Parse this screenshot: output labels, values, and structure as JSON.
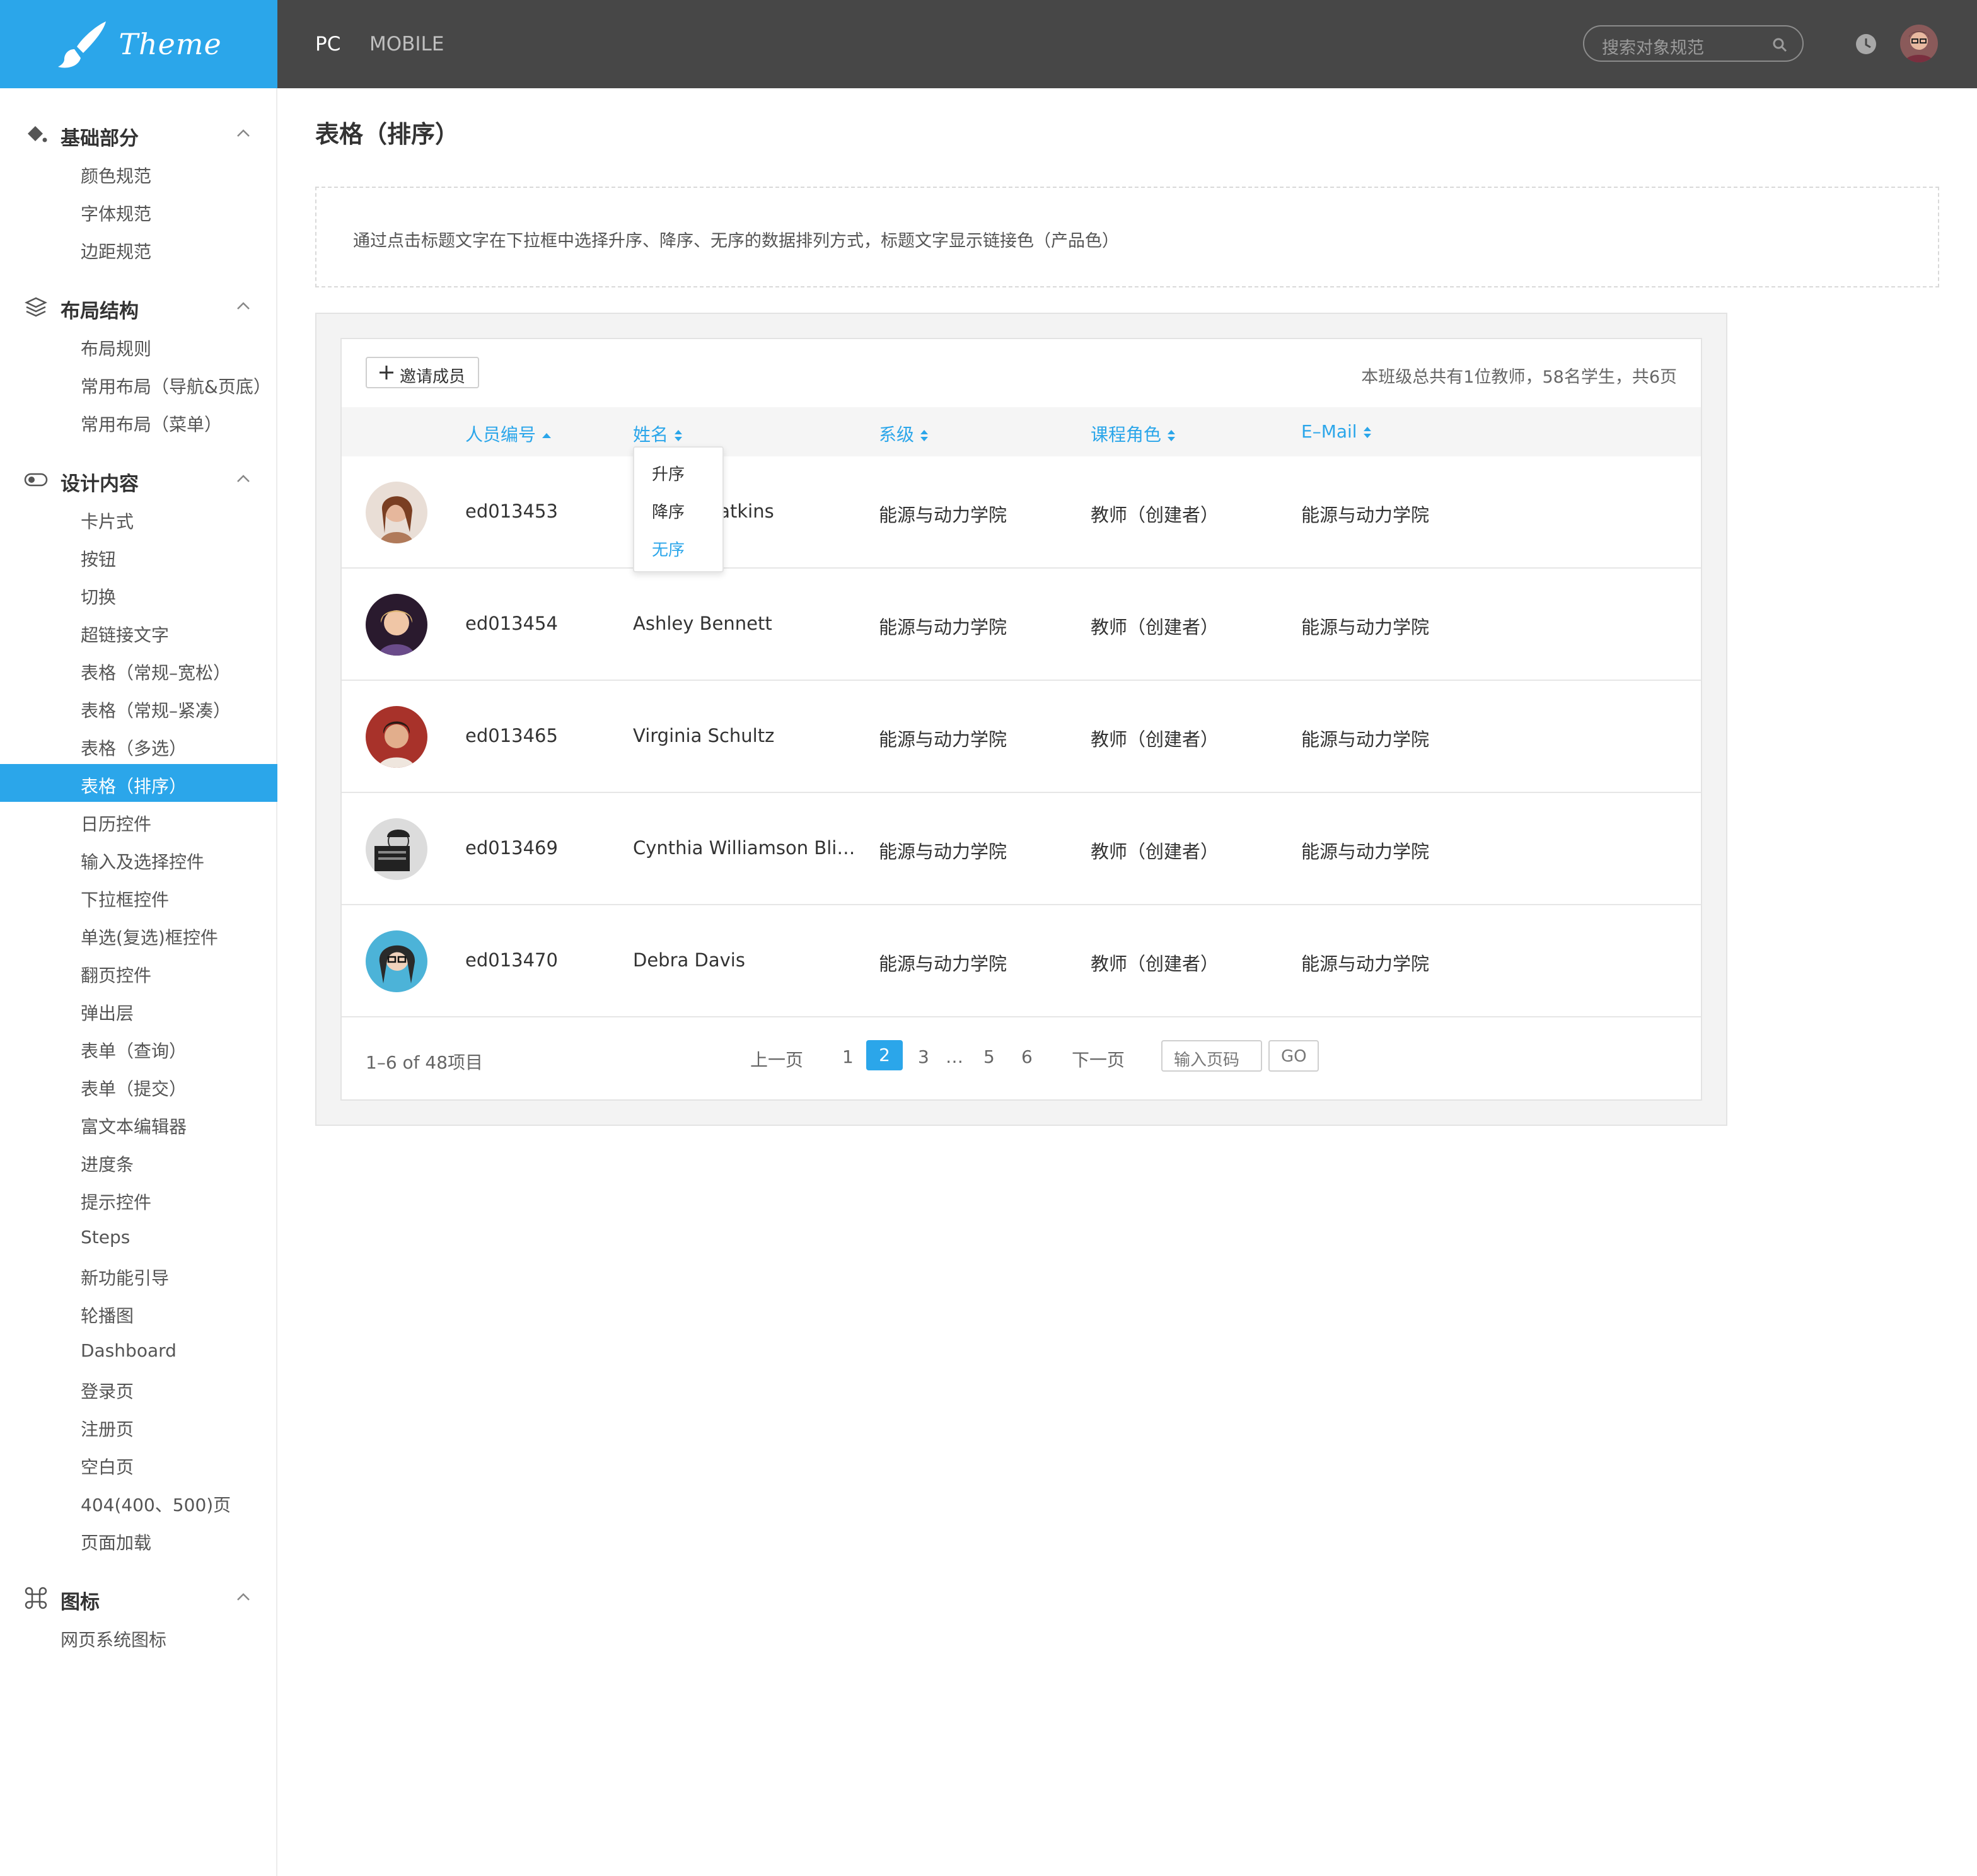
{
  "app": {
    "brand": "Theme",
    "tabs": [
      "PC",
      "MOBILE"
    ],
    "search_placeholder": "搜索对象规范",
    "accent_color": "#2ba6ea",
    "topbar_color": "#474747"
  },
  "sidebar": {
    "groups": [
      {
        "title": "基础部分",
        "icon": "paint-bucket-icon",
        "items": [
          "颜色规范",
          "字体规范",
          "边距规范"
        ]
      },
      {
        "title": "布局结构",
        "icon": "layers-icon",
        "items": [
          "布局规则",
          "常用布局（导航&页底）",
          "常用布局（菜单）"
        ]
      },
      {
        "title": "设计内容",
        "icon": "toggle-icon",
        "items": [
          "卡片式",
          "按钮",
          "切换",
          "超链接文字",
          "表格（常规–宽松）",
          "表格（常规–紧凑）",
          "表格（多选）",
          "表格（排序）",
          "日历控件",
          "输入及选择控件",
          "下拉框控件",
          "单选(复选)框控件",
          "翻页控件",
          "弹出层",
          "表单（查询）",
          "表单（提交）",
          "富文本编辑器",
          "进度条",
          "提示控件",
          "Steps",
          "新功能引导",
          "轮播图",
          "Dashboard",
          "登录页",
          "注册页",
          "空白页",
          "404(400、500)页",
          "页面加载"
        ],
        "active": "表格（排序）"
      },
      {
        "title": "图标",
        "icon": "command-icon",
        "items": [
          "网页系统图标"
        ]
      }
    ]
  },
  "main": {
    "title": "表格（排序）",
    "description": "通过点击标题文字在下拉框中选择升序、降序、无序的数据排列方式，标题文字显示链接色（产品色）",
    "invite_label": "邀请成员",
    "summary": "本班级总共有1位教师，58名学生，共6页",
    "columns": [
      "人员编号",
      "姓名",
      "系级",
      "课程角色",
      "E–Mail"
    ],
    "sort_dropdown": {
      "options": [
        "升序",
        "降序",
        "无序"
      ],
      "selected": "无序"
    },
    "rows": [
      {
        "id": "ed013453",
        "name": "Harriet Watkins",
        "dept": "能源与动力学院",
        "role": "教师（创建者）",
        "email": "能源与动力学院"
      },
      {
        "id": "ed013454",
        "name": "Ashley Bennett",
        "dept": "能源与动力学院",
        "role": "教师（创建者）",
        "email": "能源与动力学院"
      },
      {
        "id": "ed013465",
        "name": "Virginia Schultz",
        "dept": "能源与动力学院",
        "role": "教师（创建者）",
        "email": "能源与动力学院"
      },
      {
        "id": "ed013469",
        "name": "Cynthia Williamson Bli…",
        "dept": "能源与动力学院",
        "role": "教师（创建者）",
        "email": "能源与动力学院"
      },
      {
        "id": "ed013470",
        "name": "Debra Davis",
        "dept": "能源与动力学院",
        "role": "教师（创建者）",
        "email": "能源与动力学院"
      }
    ],
    "pagination": {
      "range_text": "1–6 of 48项目",
      "prev": "上一页",
      "pages": [
        "1",
        "2",
        "3",
        "…",
        "5",
        "6"
      ],
      "current": "2",
      "next": "下一页",
      "input_placeholder": "输入页码",
      "go": "GO"
    }
  }
}
